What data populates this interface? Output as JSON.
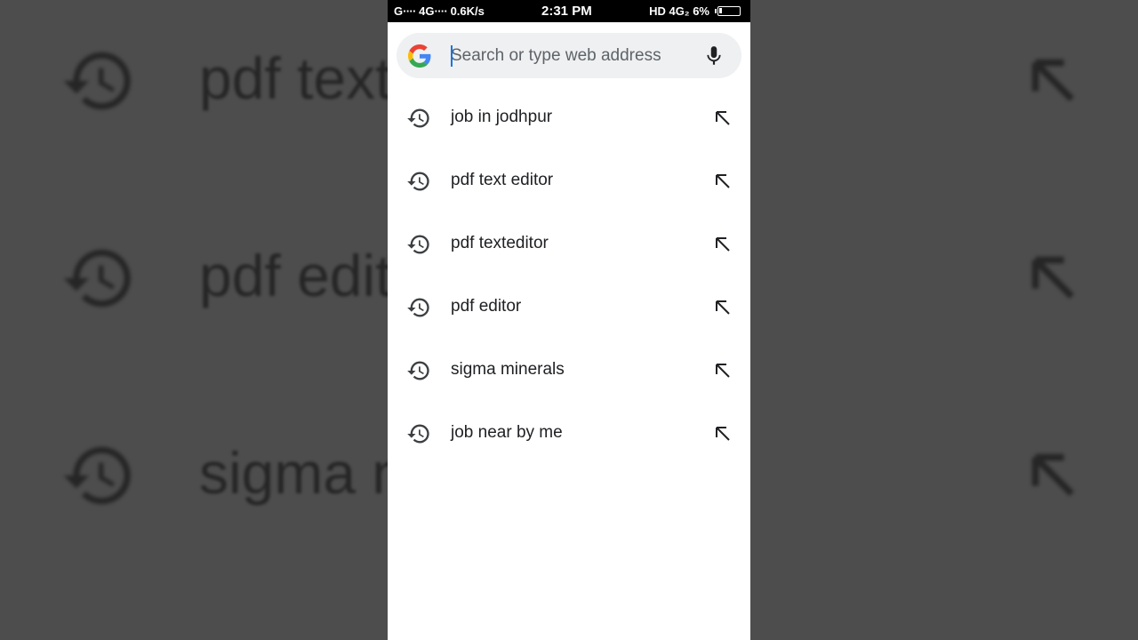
{
  "status_bar": {
    "left": "G∙∙∙∙ 4G∙∙∙∙ 0.6K/s",
    "time": "2:31 PM",
    "right": "HD 4G₂ 6%"
  },
  "search": {
    "placeholder": "Search or type web address",
    "value": ""
  },
  "suggestions": [
    {
      "text": "job in jodhpur"
    },
    {
      "text": "pdf text editor"
    },
    {
      "text": "pdf texteditor"
    },
    {
      "text": "pdf editor"
    },
    {
      "text": "sigma minerals"
    },
    {
      "text": "job near by me"
    }
  ],
  "background_blur": {
    "rows": [
      "pdf text",
      "pdf edit",
      "sigma n"
    ]
  },
  "icons": {
    "suggestion_leading": "history-icon",
    "suggestion_trailing": "fill-query-arrow-icon",
    "search_leading": "google-logo",
    "search_trailing": "mic-icon"
  },
  "colors": {
    "google_blue": "#4285F4",
    "google_red": "#EA4335",
    "google_yellow": "#FBBC05",
    "google_green": "#34A853",
    "text_primary": "#202124",
    "search_bg": "#eef0f1"
  }
}
